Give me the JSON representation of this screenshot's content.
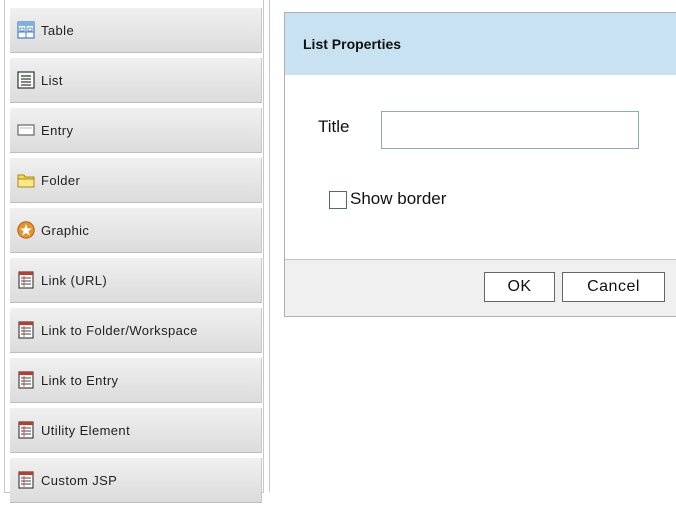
{
  "palette": {
    "items": [
      {
        "label": "Table",
        "icon": "table-icon"
      },
      {
        "label": "List",
        "icon": "list-icon"
      },
      {
        "label": "Entry",
        "icon": "entry-icon"
      },
      {
        "label": "Folder",
        "icon": "folder-icon"
      },
      {
        "label": "Graphic",
        "icon": "graphic-icon"
      },
      {
        "label": "Link (URL)",
        "icon": "link-url-icon"
      },
      {
        "label": "Link to Folder/Workspace",
        "icon": "link-folder-icon"
      },
      {
        "label": "Link to Entry",
        "icon": "link-entry-icon"
      },
      {
        "label": "Utility Element",
        "icon": "utility-icon"
      },
      {
        "label": "Custom JSP",
        "icon": "custom-jsp-icon"
      }
    ]
  },
  "dialog": {
    "title": "List Properties",
    "title_label": "Title",
    "title_value": "",
    "show_border_label": "Show border",
    "show_border_checked": false,
    "ok_label": "OK",
    "cancel_label": "Cancel"
  },
  "colors": {
    "header_bg": "#c8e2f2",
    "item_bg": "#e4e4e4"
  }
}
